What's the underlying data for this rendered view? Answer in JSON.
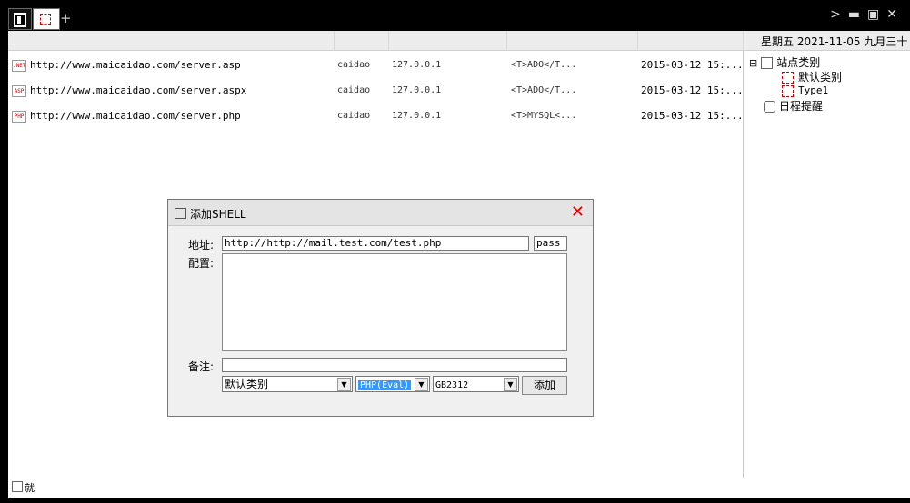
{
  "header": {
    "date": "星期五 2021-11-05 九月三十"
  },
  "rows": [
    {
      "type_icon": ".NET",
      "url": "http://www.maicaidao.com/server.asp",
      "password": "caidao",
      "ip": "127.0.0.1",
      "db_type": "<T>ADO</T...",
      "date": "2015-03-12 15:..."
    },
    {
      "type_icon": "ASP",
      "url": "http://www.maicaidao.com/server.aspx",
      "password": "caidao",
      "ip": "127.0.0.1",
      "db_type": "<T>ADO</T...",
      "date": "2015-03-12 15:..."
    },
    {
      "type_icon": "PHP",
      "url": "http://www.maicaidao.com/server.php",
      "password": "caidao",
      "ip": "127.0.0.1",
      "db_type": "<T>MYSQL<...",
      "date": "2015-03-12 15:..."
    }
  ],
  "sidebar": {
    "site_categories": "站点类别",
    "default_category": "默认类别",
    "type1": "Type1",
    "schedule": "日程提醒"
  },
  "status": {
    "text": "就"
  },
  "dialog": {
    "title": "添加SHELL",
    "address_label": "地址:",
    "address_value": "http://http://mail.test.com/test.php",
    "password_value": "pass",
    "config_label": "配置:",
    "config_value": "",
    "note_label": "备注:",
    "note_value": "",
    "category_select": "默认类别",
    "script_select": "PHP(Eval)",
    "encoding_select": "GB2312",
    "add_button": "添加"
  }
}
